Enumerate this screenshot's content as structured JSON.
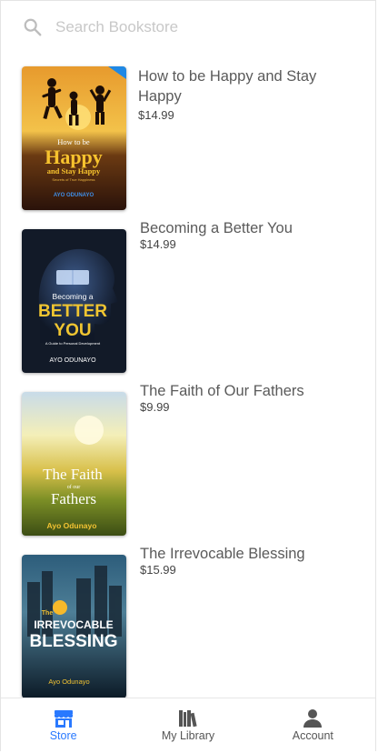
{
  "colors": {
    "accent": "#2979ff",
    "text": "#5a5a5a",
    "inactive": "#555555",
    "placeholder": "#c8c8c8"
  },
  "search": {
    "placeholder": "Search Bookstore",
    "value": "",
    "icon": "search-icon"
  },
  "books": [
    {
      "title": "How to be Happy and Stay Happy",
      "price": "$14.99",
      "cover": {
        "line1": "How to be",
        "line2": "Happy",
        "line3": "and Stay Happy",
        "tagline": "Secrets of True Happiness",
        "author": "AYO ODUNAYO"
      }
    },
    {
      "title": "Becoming a Better You",
      "price": "$14.99",
      "cover": {
        "line1": "Becoming a",
        "line2": "BETTER",
        "line3": "YOU",
        "tagline": "A Guide to Personal Development",
        "author": "AYO ODUNAYO"
      }
    },
    {
      "title": "The Faith of Our Fathers",
      "price": "$9.99",
      "cover": {
        "line1": "The Faith",
        "line2": "of our",
        "line3": "Fathers",
        "author": "Ayo Odunayo"
      }
    },
    {
      "title": "The Irrevocable Blessing",
      "price": "$15.99",
      "cover": {
        "line1": "The",
        "line2": "IRREVOCABLE",
        "line3": "BLESSING",
        "author": "Ayo Odunayo"
      }
    }
  ],
  "tabs": [
    {
      "label": "Store",
      "icon": "store-icon",
      "active": true
    },
    {
      "label": "My Library",
      "icon": "library-icon",
      "active": false
    },
    {
      "label": "Account",
      "icon": "account-icon",
      "active": false
    }
  ]
}
